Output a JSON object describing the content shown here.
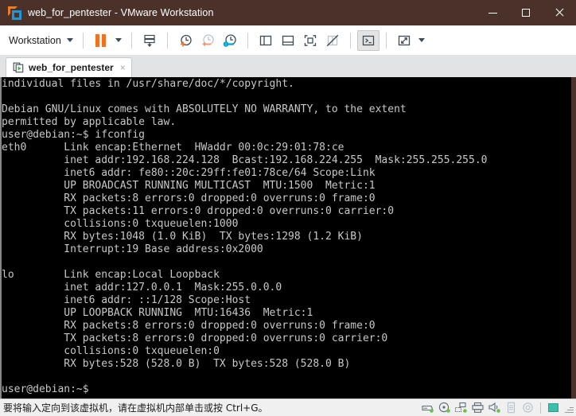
{
  "window": {
    "title": "web_for_pentester - VMware Workstation",
    "logo_icon": "vmware-logo-icon",
    "controls": {
      "minimize": "minimize-icon",
      "maximize": "maximize-icon",
      "close": "close-icon"
    }
  },
  "toolbar": {
    "menu_label": "Workstation",
    "items": [
      {
        "name": "workstation-menu",
        "icon": "chevron-down-icon"
      },
      {
        "name": "suspend-button",
        "icon": "pause-icon"
      },
      {
        "name": "power-dropdown",
        "icon": "chevron-down-icon"
      },
      {
        "name": "manage-snapshots-button",
        "icon": "snapshot-stack-icon"
      },
      {
        "name": "take-snapshot-button",
        "icon": "clock-plus-icon"
      },
      {
        "name": "revert-snapshot-button",
        "icon": "clock-back-arrow-icon"
      },
      {
        "name": "snapshot-manager-button",
        "icon": "clock-wrench-icon"
      },
      {
        "name": "show-library-button",
        "icon": "panel-left-icon"
      },
      {
        "name": "show-thumbnail-bar-button",
        "icon": "panel-bottom-icon"
      },
      {
        "name": "show-console-view-button",
        "icon": "fullscreen-brackets-icon"
      },
      {
        "name": "hide-thumbnails-button",
        "icon": "panel-crossed-icon"
      },
      {
        "name": "send-ctrl-alt-del-button",
        "icon": "terminal-prompt-icon"
      },
      {
        "name": "enter-fullscreen-button",
        "icon": "expand-diagonal-icon"
      },
      {
        "name": "fullscreen-dropdown",
        "icon": "chevron-down-icon"
      }
    ]
  },
  "tab": {
    "label": "web_for_pentester",
    "icon": "vm-play-icon",
    "close_label": "×"
  },
  "terminal": {
    "lines": [
      "individual files in /usr/share/doc/*/copyright.",
      "",
      "Debian GNU/Linux comes with ABSOLUTELY NO WARRANTY, to the extent",
      "permitted by applicable law.",
      "user@debian:~$ ifconfig",
      "eth0      Link encap:Ethernet  HWaddr 00:0c:29:01:78:ce",
      "          inet addr:192.168.224.128  Bcast:192.168.224.255  Mask:255.255.255.0",
      "          inet6 addr: fe80::20c:29ff:fe01:78ce/64 Scope:Link",
      "          UP BROADCAST RUNNING MULTICAST  MTU:1500  Metric:1",
      "          RX packets:8 errors:0 dropped:0 overruns:0 frame:0",
      "          TX packets:11 errors:0 dropped:0 overruns:0 carrier:0",
      "          collisions:0 txqueuelen:1000",
      "          RX bytes:1048 (1.0 KiB)  TX bytes:1298 (1.2 KiB)",
      "          Interrupt:19 Base address:0x2000",
      "",
      "lo        Link encap:Local Loopback",
      "          inet addr:127.0.0.1  Mask:255.0.0.0",
      "          inet6 addr: ::1/128 Scope:Host",
      "          UP LOOPBACK RUNNING  MTU:16436  Metric:1",
      "          RX packets:8 errors:0 dropped:0 overruns:0 frame:0",
      "          TX packets:8 errors:0 dropped:0 overruns:0 carrier:0",
      "          collisions:0 txqueuelen:0",
      "          RX bytes:528 (528.0 B)  TX bytes:528 (528.0 B)",
      "",
      "user@debian:~$"
    ]
  },
  "statusbar": {
    "message": "要将输入定向到该虚拟机，请在虚拟机内部单击或按 Ctrl+G。",
    "icons": [
      {
        "name": "hard-disk-status-icon"
      },
      {
        "name": "cd-dvd-status-icon"
      },
      {
        "name": "network-adapter-status-icon"
      },
      {
        "name": "printer-status-icon"
      },
      {
        "name": "sound-card-status-icon"
      },
      {
        "name": "usb-device-status-icon"
      },
      {
        "name": "camera-status-icon"
      },
      {
        "name": "network-mode-indicator-icon"
      },
      {
        "name": "resize-grip-icon"
      }
    ]
  },
  "colors": {
    "titlebar_bg": "#4a312a",
    "accent_orange": "#f37021",
    "accent_blue": "#2196d6",
    "terminal_bg": "#000000",
    "terminal_fg": "#c8c8c8",
    "status_green": "#6cc04a",
    "network_teal": "#3bbfad"
  }
}
